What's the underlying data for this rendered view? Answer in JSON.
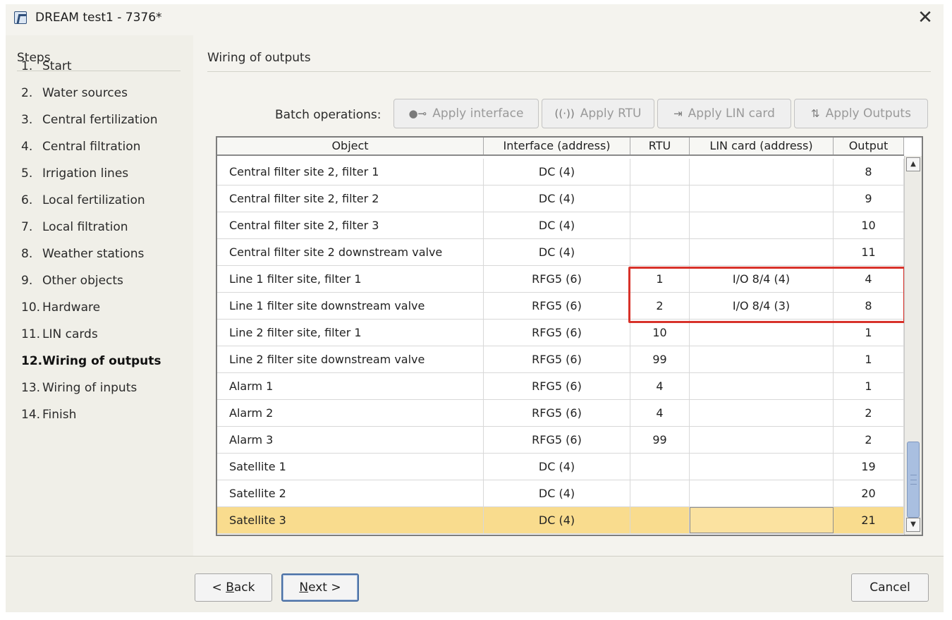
{
  "window": {
    "title": "DREAM test1 - 7376*",
    "close_glyph": "✕",
    "app_icon": "app-logo-icon"
  },
  "steps": {
    "header": "Steps",
    "items": [
      {
        "num": "1.",
        "label": "Start"
      },
      {
        "num": "2.",
        "label": "Water sources"
      },
      {
        "num": "3.",
        "label": "Central fertilization"
      },
      {
        "num": "4.",
        "label": "Central filtration"
      },
      {
        "num": "5.",
        "label": "Irrigation lines"
      },
      {
        "num": "6.",
        "label": "Local fertilization"
      },
      {
        "num": "7.",
        "label": "Local filtration"
      },
      {
        "num": "8.",
        "label": "Weather stations"
      },
      {
        "num": "9.",
        "label": "Other objects"
      },
      {
        "num": "10.",
        "label": "Hardware"
      },
      {
        "num": "11.",
        "label": "LIN cards"
      },
      {
        "num": "12.",
        "label": "Wiring of outputs",
        "active": true
      },
      {
        "num": "13.",
        "label": "Wiring of inputs"
      },
      {
        "num": "14.",
        "label": "Finish"
      }
    ]
  },
  "main": {
    "title": "Wiring of outputs",
    "batch": {
      "label": "Batch operations:",
      "buttons": [
        {
          "label": "Apply interface",
          "icon": "usb-icon"
        },
        {
          "label": "Apply RTU",
          "icon": "radio-wave-icon"
        },
        {
          "label": "Apply LIN card",
          "icon": "import-icon"
        },
        {
          "label": "Apply Outputs",
          "icon": "swap-icon"
        }
      ]
    },
    "table": {
      "columns": [
        "Object",
        "Interface (address)",
        "RTU",
        "LIN card (address)",
        "Output"
      ],
      "rows": [
        [
          "Central filter site 2, filter 1",
          "DC (4)",
          "",
          "",
          "8"
        ],
        [
          "Central filter site 2, filter 2",
          "DC (4)",
          "",
          "",
          "9"
        ],
        [
          "Central filter site 2, filter 3",
          "DC (4)",
          "",
          "",
          "10"
        ],
        [
          "Central filter site 2 downstream valve",
          "DC (4)",
          "",
          "",
          "11"
        ],
        [
          "Line 1 filter site, filter 1",
          "RFG5 (6)",
          "1",
          "I/O 8/4 (4)",
          "4"
        ],
        [
          "Line 1 filter site downstream valve",
          "RFG5 (6)",
          "2",
          "I/O 8/4 (3)",
          "8"
        ],
        [
          "Line 2 filter site, filter 1",
          "RFG5 (6)",
          "10",
          "",
          "1"
        ],
        [
          "Line 2 filter site downstream valve",
          "RFG5 (6)",
          "99",
          "",
          "1"
        ],
        [
          "Alarm 1",
          "RFG5 (6)",
          "4",
          "",
          "1"
        ],
        [
          "Alarm 2",
          "RFG5 (6)",
          "4",
          "",
          "2"
        ],
        [
          "Alarm 3",
          "RFG5 (6)",
          "99",
          "",
          "2"
        ],
        [
          "Satellite 1",
          "DC (4)",
          "",
          "",
          "19"
        ],
        [
          "Satellite 2",
          "DC (4)",
          "",
          "",
          "20"
        ],
        [
          "Satellite 3",
          "DC (4)",
          "",
          "",
          "21"
        ]
      ],
      "selected_row": 13,
      "scroll_up_glyph": "▲",
      "scroll_down_glyph": "▼"
    }
  },
  "footer": {
    "back": {
      "prefix": "< ",
      "accel": "B",
      "rest": "ack"
    },
    "next": {
      "accel": "N",
      "rest": "ext >"
    },
    "cancel": "Cancel"
  },
  "colors": {
    "selected_row": "#f9dc8e",
    "highlight_border": "#d8322a",
    "scroll_thumb": "#a9bfe0"
  }
}
